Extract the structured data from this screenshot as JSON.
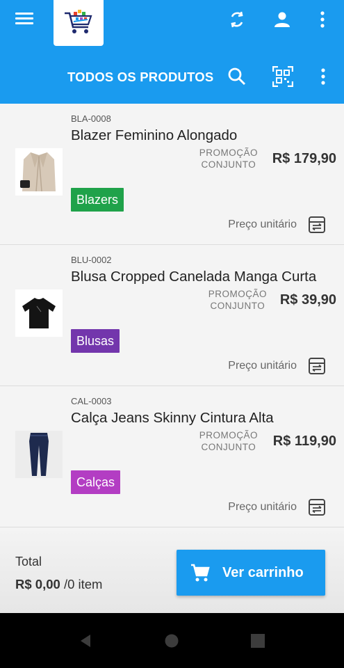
{
  "header": {
    "subtitle": "TODOS OS PRODUTOS"
  },
  "products": [
    {
      "sku": "BLA-0008",
      "name": "Blazer Feminino Alongado",
      "promo_line1": "PROMOÇÃO",
      "promo_line2": "CONJUNTO",
      "price": "R$ 179,90",
      "category": "Blazers",
      "category_color": "#1fa24a",
      "unit_label": "Preço unitário"
    },
    {
      "sku": "BLU-0002",
      "name": "Blusa Cropped Canelada Manga Curta",
      "promo_line1": "PROMOÇÃO",
      "promo_line2": "CONJUNTO",
      "price": "R$ 39,90",
      "category": "Blusas",
      "category_color": "#7336ac",
      "unit_label": "Preço unitário"
    },
    {
      "sku": "CAL-0003",
      "name": "Calça Jeans Skinny Cintura Alta",
      "promo_line1": "PROMOÇÃO",
      "promo_line2": "CONJUNTO",
      "price": "R$ 119,90",
      "category": "Calças",
      "category_color": "#b33dc3",
      "unit_label": "Preço unitário"
    }
  ],
  "footer": {
    "total_label": "Total",
    "total_value": "R$ 0,00",
    "total_items": "/0 item",
    "cart_button": "Ver carrinho"
  },
  "colors": {
    "primary": "#1a9bef"
  }
}
